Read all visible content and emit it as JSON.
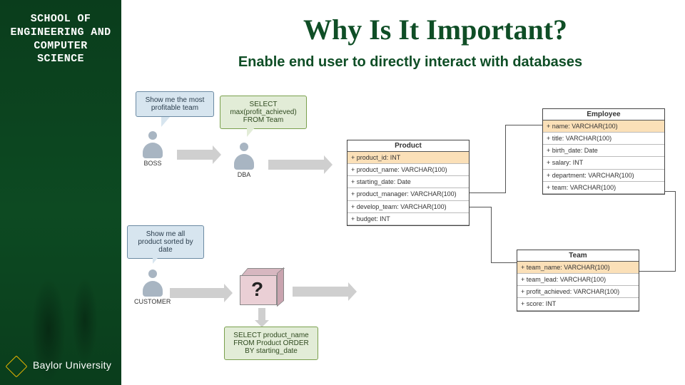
{
  "sidebar": {
    "school_label": "SCHOOL OF ENGINEERING AND COMPUTER SCIENCE",
    "brand": "Baylor University"
  },
  "title": "Why Is It Important?",
  "subtitle": "Enable end user to directly interact with databases",
  "bubbles": {
    "boss": "Show me the most profitable team",
    "dba_sql": "SELECT max(profit_achieved) FROM Team",
    "customer": "Show me all product sorted by date",
    "result_sql": "SELECT product_name FROM Product ORDER BY starting_date"
  },
  "actors": {
    "boss": "BOSS",
    "dba": "DBA",
    "customer": "CUSTOMER"
  },
  "question": "?",
  "schema": {
    "product": {
      "name": "Product",
      "fields": [
        "+ product_id: INT",
        "+ product_name: VARCHAR(100)",
        "+ starting_date: Date",
        "+ product_manager: VARCHAR(100)",
        "+ develop_team: VARCHAR(100)",
        "+ budget: INT"
      ]
    },
    "employee": {
      "name": "Employee",
      "fields": [
        "+ name: VARCHAR(100)",
        "+ title: VARCHAR(100)",
        "+ birth_date: Date",
        "+ salary: INT",
        "+ department: VARCHAR(100)",
        "+ team: VARCHAR(100)"
      ]
    },
    "team": {
      "name": "Team",
      "fields": [
        "+ team_name: VARCHAR(100)",
        "+ team_lead: VARCHAR(100)",
        "+ profit_achieved: VARCHAR(100)",
        "+ score: INT"
      ]
    }
  }
}
